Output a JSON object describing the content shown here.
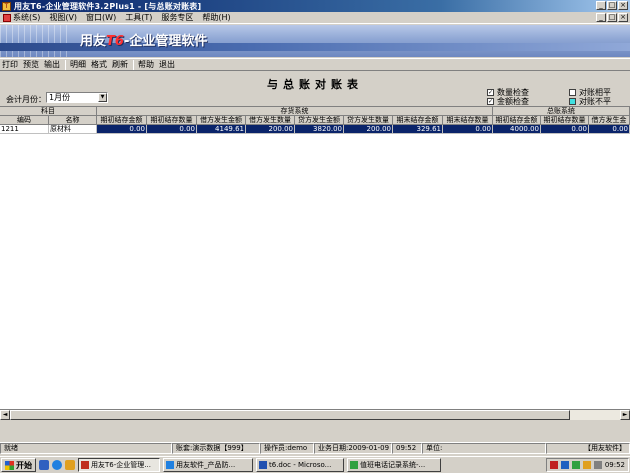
{
  "window": {
    "title": "用友T6-企业管理软件3.2Plus1 - [与总账对账表]",
    "app_icon_text": "T"
  },
  "menubar": {
    "items": [
      "系统(S)",
      "视图(V)",
      "窗口(W)",
      "工具(T)",
      "服务专区",
      "帮助(H)"
    ]
  },
  "banner": {
    "brand_prefix": "用友",
    "brand_t6": "T6",
    "brand_suffix": "-企业管理软件"
  },
  "toolbar": {
    "group1": [
      "打印",
      "预览",
      "输出"
    ],
    "group2": [
      "明细",
      "格式",
      "刷新"
    ],
    "group3": [
      "帮助",
      "退出"
    ]
  },
  "report": {
    "title": "与总账对账表",
    "month_label": "会计月份：",
    "month_value": "1月份",
    "checks": {
      "qty_check": {
        "label": "数量检查",
        "checked": true
      },
      "amount_check": {
        "label": "金额检查",
        "checked": true
      },
      "balanced": {
        "label": "对账相平"
      },
      "unbalanced": {
        "label": "对账不平"
      }
    }
  },
  "grid": {
    "group_headers": {
      "subject": "科目",
      "inventory": "存货系统",
      "ledger": "总账系统"
    },
    "columns": [
      "编码",
      "名称",
      "期初结存金额",
      "期初结存数量",
      "借方发生金额",
      "借方发生数量",
      "贷方发生金额",
      "贷方发生数量",
      "期末结存金额",
      "期末结存数量",
      "期初结存金额",
      "期初结存数量",
      "借方发生金"
    ],
    "rows": [
      [
        "1211",
        "原材料",
        "0.00",
        "0.00",
        "4149.61",
        "200.00",
        "3820.00",
        "200.00",
        "329.61",
        "0.00",
        "4000.00",
        "0.00",
        "0.00"
      ]
    ]
  },
  "statusbar": {
    "ready": "就绪",
    "account": "账套:演示数据【999】",
    "operator": "操作员:demo",
    "date": "业务日期:2009-01-09",
    "time": "09:52",
    "unit": "单位:",
    "vendor": "【用友软件】"
  },
  "taskbar": {
    "start": "开始",
    "tasks": [
      "用友T6-企业管理...",
      "用友软件_产品防...",
      "t6.doc - Microso...",
      "值班电话记录系统-..."
    ],
    "clock": "09:52"
  },
  "colors": {
    "titlebar": "#0a246a",
    "selection": "#0a246a",
    "chrome": "#d4d0c8"
  }
}
